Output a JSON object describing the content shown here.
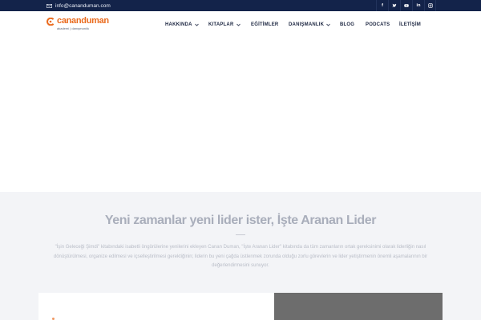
{
  "topbar": {
    "email": "info@cananduman.com",
    "email_icon": "mail-icon",
    "socials": [
      {
        "name": "facebook-icon",
        "glyph": "f"
      },
      {
        "name": "twitter-icon",
        "glyph": "t"
      },
      {
        "name": "youtube-icon",
        "glyph": "▶"
      },
      {
        "name": "linkedin-icon",
        "glyph": "in"
      },
      {
        "name": "instagram-icon",
        "glyph": "◎"
      }
    ]
  },
  "header": {
    "logo_text": "cananduman",
    "logo_tagline": "akademi | danışmanlık",
    "nav": [
      {
        "label": "HAKKINDA",
        "dropdown": true
      },
      {
        "label": "KITAPLAR",
        "dropdown": true
      },
      {
        "label": "EĞİTİMLER",
        "dropdown": false
      },
      {
        "label": "DANIŞMANLIK",
        "dropdown": true
      },
      {
        "label": "BLOG",
        "dropdown": false
      },
      {
        "label": "PODCATS",
        "dropdown": false
      },
      {
        "label": "İLETİŞİM",
        "dropdown": false
      }
    ]
  },
  "intro": {
    "title": "Yeni zamanlar yeni lider ister, İşte Aranan Lider",
    "description": "\"İşin Geleceği Şimdi\" kitabındaki isabetli öngörülerine yenilerini ekleyen Canan Duman, \"İşte Aranan Lider\" kitabında da tüm zamanların ortak gereksinimi olarak liderliğin nasıl dönüştürülmesi, organize edilmesi ve içselleştirilmesi gerektiğinin; liderin bu yeni çağda üstlenmek zorunda olduğu zorlu görevlerin ve lider yetiştirmenin önemli aşamalarının bir değerlendirmesini sunuyor."
  },
  "colors": {
    "topbar_bg": "#13234a",
    "brand_orange": "#ea6b1e",
    "nav_text": "#1b2540",
    "section_bg": "#f3f4f7",
    "card_dark": "#6d6d6d"
  }
}
